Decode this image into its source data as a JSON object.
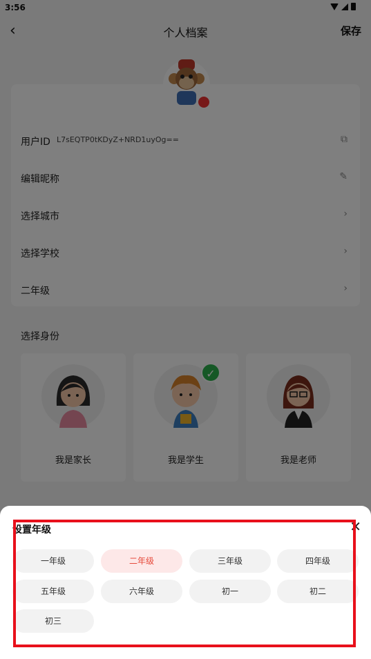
{
  "status": {
    "time": "3:56"
  },
  "header": {
    "back_icon": "chevron-left-icon",
    "title": "个人档案",
    "save_label": "保存"
  },
  "profile": {
    "uid_label": "用户ID",
    "uid_value": "L7sEQTP0tKDyZ+NRD1uyOg==",
    "rows": [
      {
        "label": "编辑昵称",
        "icon": "pencil-icon"
      },
      {
        "label": "选择城市",
        "icon": "chevron-right-icon"
      },
      {
        "label": "选择学校",
        "icon": "chevron-right-icon"
      },
      {
        "label": "二年级",
        "icon": "chevron-right-icon"
      }
    ]
  },
  "identity": {
    "title": "选择身份",
    "roles": [
      {
        "label": "我是家长",
        "selected": false
      },
      {
        "label": "我是学生",
        "selected": true
      },
      {
        "label": "我是老师",
        "selected": false
      }
    ]
  },
  "sheet": {
    "title": "设置年级",
    "close_icon": "close-icon",
    "grades": [
      "一年级",
      "二年级",
      "三年级",
      "四年级",
      "五年级",
      "六年级",
      "初一",
      "初二",
      "初三"
    ],
    "selected": "二年级"
  },
  "colors": {
    "accent": "#e64a3b",
    "check": "#2db14c",
    "highlight": "#e8101b"
  }
}
